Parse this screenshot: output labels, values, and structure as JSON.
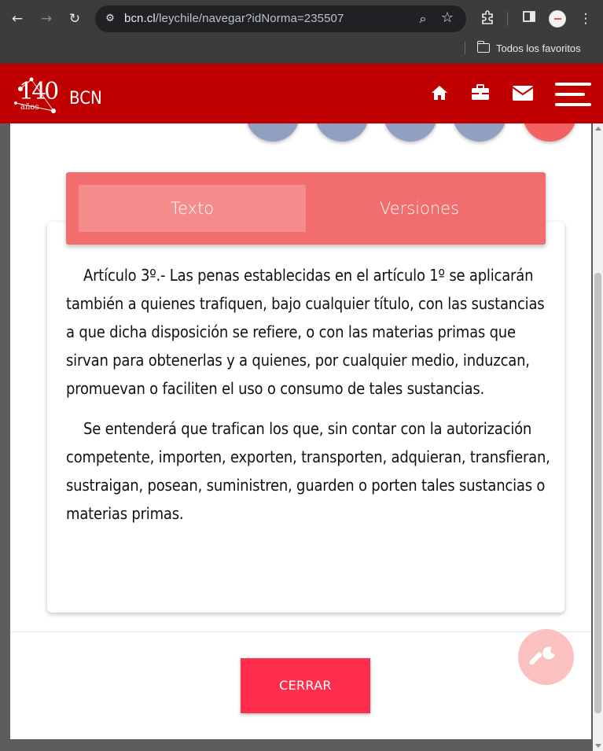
{
  "browser": {
    "url_host": "bcn.cl",
    "url_path": "/leychile/navegar?idNorma=235507",
    "bookmarks_label": "Todos los favoritos"
  },
  "header": {
    "logo_number": "140",
    "logo_sub": "años",
    "title": "BCN",
    "icons": [
      "home-icon",
      "briefcase-icon",
      "envelope-icon",
      "menu-icon"
    ],
    "color": "#c00000"
  },
  "tabs": {
    "texto": "Texto",
    "versiones": "Versiones"
  },
  "article": {
    "p1": "Artículo 3º.- Las penas establecidas en el artículo 1º se aplicarán también a quienes trafiquen, bajo cualquier título, con las sustancias a que dicha disposición se refiere, o con las materias primas que sirvan para obtenerlas y a quienes, por cualquier medio, induzcan, promuevan o faciliten el uso o consumo de tales sustancias.",
    "p2": "Se entenderá que trafican los que, sin contar con la autorización competente, importen, exporten, transporten, adquieran, transfieran, sustraigan, posean, suministren, guarden o porten tales sustancias o materias primas."
  },
  "actions": {
    "close_label": "CERRAR",
    "close_color": "#ff2e4d",
    "fab_icon": "wrench-icon"
  }
}
